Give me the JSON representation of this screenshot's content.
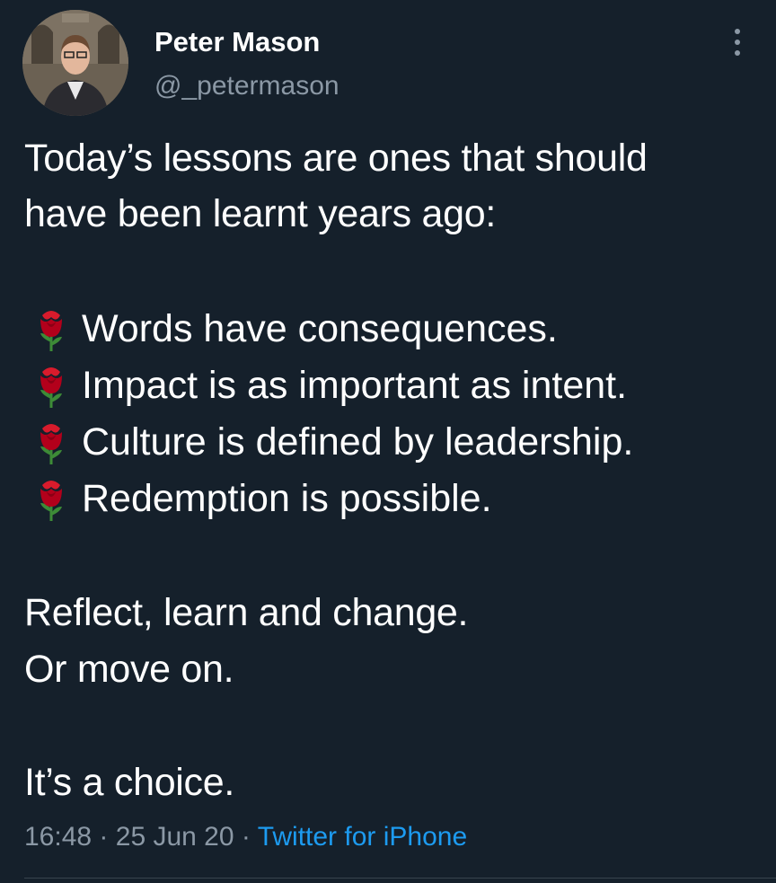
{
  "author": {
    "name": "Peter Mason",
    "handle": "@_petermason",
    "avatar": "avatar-photo"
  },
  "more_icon": "more-vertical-icon",
  "tweet": {
    "intro": [
      "Today’s lessons are ones that should",
      "have been learnt years ago:"
    ],
    "bullet_icon": "rose-icon",
    "bullets": [
      "Words have consequences.",
      "Impact is as important as intent.",
      "Culture is defined by leadership.",
      "Redemption is possible."
    ],
    "closing": [
      "Reflect, learn and change.",
      "Or move on."
    ],
    "final": "It’s a choice."
  },
  "meta": {
    "time": "16:48",
    "separator": "·",
    "date": "25 Jun 20",
    "source": "Twitter for iPhone"
  },
  "colors": {
    "background": "#15202b",
    "text": "#ffffff",
    "secondary": "#8b98a5",
    "link": "#1d9bf0",
    "rose": "#c8102e"
  }
}
